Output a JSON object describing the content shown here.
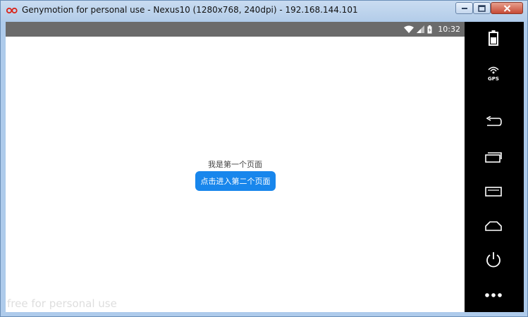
{
  "window": {
    "title": "Genymotion for personal use - Nexus10 (1280x768, 240dpi) - 192.168.144.101"
  },
  "status_bar": {
    "time": "10:32"
  },
  "screen": {
    "page_label": "我是第一个页面",
    "button_label": "点击进入第二个页面",
    "watermark": "free for personal use"
  },
  "sidebar": {
    "gps_label": "GPS"
  },
  "colors": {
    "button_blue": "#1886ec",
    "status_bar": "#6b6b6b",
    "sidebar": "#000000"
  }
}
